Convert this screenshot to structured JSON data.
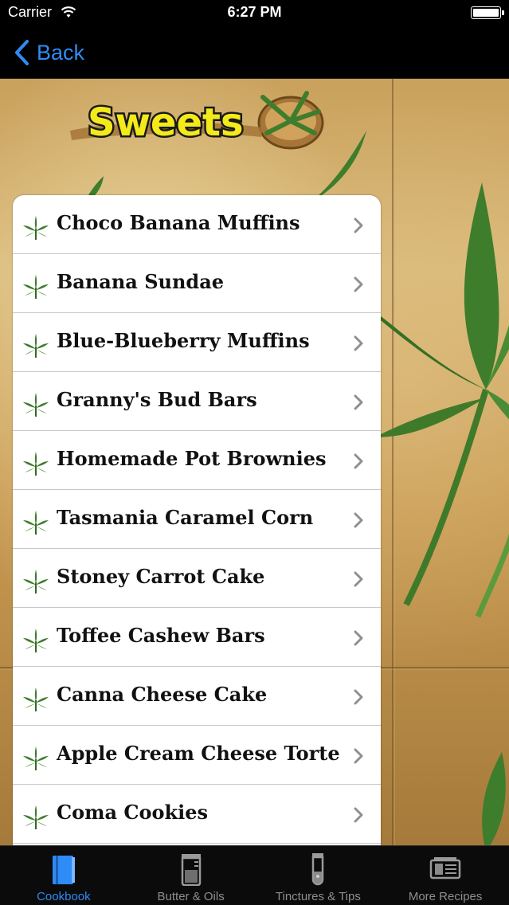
{
  "status_bar": {
    "carrier": "Carrier",
    "time": "6:27 PM"
  },
  "nav": {
    "back_label": "Back"
  },
  "logo": {
    "text": "Sweets"
  },
  "recipes": [
    {
      "label": "Choco Banana Muffins"
    },
    {
      "label": "Banana Sundae"
    },
    {
      "label": "Blue-Blueberry Muffins"
    },
    {
      "label": "Granny's Bud Bars"
    },
    {
      "label": "Homemade Pot Brownies"
    },
    {
      "label": "Tasmania Caramel Corn"
    },
    {
      "label": "Stoney Carrot Cake"
    },
    {
      "label": "Toffee Cashew Bars"
    },
    {
      "label": "Canna Cheese Cake"
    },
    {
      "label": "Apple Cream Cheese Torte"
    },
    {
      "label": "Coma Cookies"
    }
  ],
  "tabs": [
    {
      "label": "Cookbook",
      "icon": "book-icon",
      "active": true
    },
    {
      "label": "Butter & Oils",
      "icon": "jar-icon",
      "active": false
    },
    {
      "label": "Tinctures & Tips",
      "icon": "test-tube-icon",
      "active": false
    },
    {
      "label": "More Recipes",
      "icon": "stack-icon",
      "active": false
    }
  ],
  "colors": {
    "accent": "#2f8bf6",
    "tab_inactive": "#8e8e93",
    "logo_yellow": "#f3ea1a"
  }
}
